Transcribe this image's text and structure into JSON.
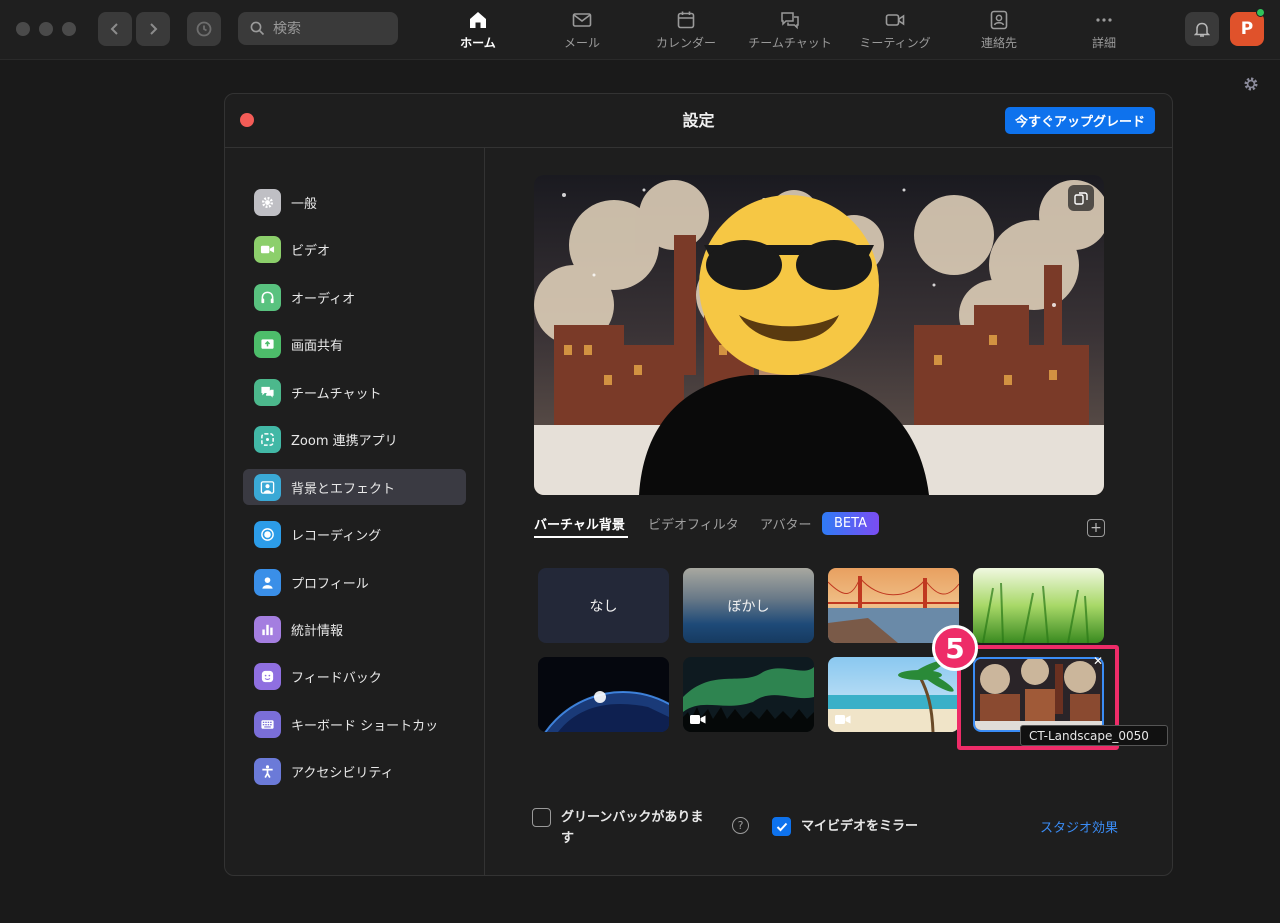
{
  "topbar": {
    "search_placeholder": "検索",
    "nav": [
      {
        "label": "ホーム",
        "icon": "home-icon",
        "active": true
      },
      {
        "label": "メール",
        "icon": "mail-icon"
      },
      {
        "label": "カレンダー",
        "icon": "calendar-icon"
      },
      {
        "label": "チームチャット",
        "icon": "chat-icon"
      },
      {
        "label": "ミーティング",
        "icon": "video-icon"
      },
      {
        "label": "連絡先",
        "icon": "contacts-icon"
      },
      {
        "label": "詳細",
        "icon": "more-icon"
      }
    ],
    "avatar_initial": "P"
  },
  "settings": {
    "title": "設定",
    "upgrade_label": "今すぐアップグレード",
    "sidebar": [
      {
        "label": "一般",
        "icon": "gear-icon",
        "color": "#bfbfc4"
      },
      {
        "label": "ビデオ",
        "icon": "video-icon",
        "color": "#8ccf6b"
      },
      {
        "label": "オーディオ",
        "icon": "headphones-icon",
        "color": "#59c27f"
      },
      {
        "label": "画面共有",
        "icon": "share-screen-icon",
        "color": "#4dbd6a"
      },
      {
        "label": "チームチャット",
        "icon": "chat-icon",
        "color": "#4cb88c"
      },
      {
        "label": "Zoom 連携アプリ",
        "icon": "apps-icon",
        "color": "#42b8a6"
      },
      {
        "label": "背景とエフェクト",
        "icon": "person-background-icon",
        "color": "#3aa9d6",
        "active": true
      },
      {
        "label": "レコーディング",
        "icon": "record-icon",
        "color": "#2c9ce8"
      },
      {
        "label": "プロフィール",
        "icon": "profile-icon",
        "color": "#3a8fe8"
      },
      {
        "label": "統計情報",
        "icon": "stats-icon",
        "color": "#a47ee0"
      },
      {
        "label": "フィードバック",
        "icon": "smile-icon",
        "color": "#8f6fe0"
      },
      {
        "label": "キーボード ショートカッ",
        "icon": "keyboard-icon",
        "color": "#7a6ed8"
      },
      {
        "label": "アクセシビリティ",
        "icon": "accessibility-icon",
        "color": "#6b7ad8"
      }
    ],
    "tabs": [
      {
        "label": "バーチャル背景",
        "active": true
      },
      {
        "label": "ビデオフィルタ"
      },
      {
        "label": "アバター"
      }
    ],
    "beta_label": "BETA",
    "backgrounds": [
      {
        "label": "なし"
      },
      {
        "label": "ぼかし"
      },
      {
        "label": "",
        "name": "golden-gate"
      },
      {
        "label": "",
        "name": "grass"
      },
      {
        "label": "",
        "name": "earth-space"
      },
      {
        "label": "",
        "name": "aurora",
        "video": true
      },
      {
        "label": "",
        "name": "beach",
        "video": true
      },
      {
        "label": "",
        "name": "ct-landscape",
        "selected": true
      }
    ],
    "annotation_number": "5",
    "tooltip": "CT-Landscape_0050",
    "green_screen_label": "グリーンバックがあります",
    "mirror_label": "マイビデオをミラー",
    "mirror_checked": true,
    "green_screen_checked": false,
    "studio_effects_label": "スタジオ効果"
  }
}
